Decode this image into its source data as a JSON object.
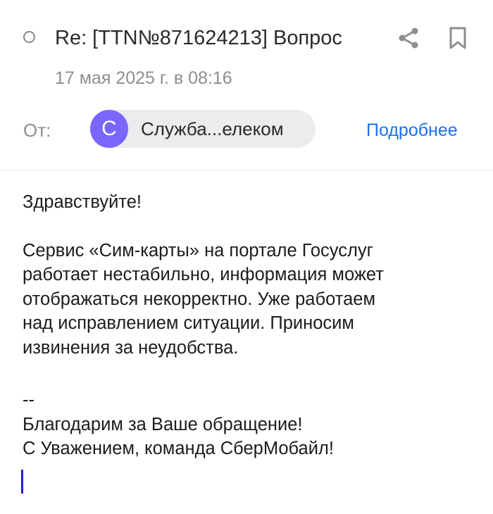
{
  "email": {
    "subject": "Re: [TTN№871624213] Вопрос",
    "date": "17 мая 2025 г. в 08:16",
    "from_label": "От:",
    "sender": {
      "avatar_letter": "С",
      "name": "Служба...елеком"
    },
    "details_link": "Подробнее",
    "icons": {
      "unread": "unread-dot-icon",
      "share": "share-icon",
      "bookmark": "bookmark-icon"
    },
    "body": {
      "greeting": "Здравствуйте!",
      "message_lines": [
        "Сервис «Сим-карты» на портале Госуслуг",
        "работает нестабильно, информация может",
        "отображаться некорректно. Уже работаем",
        "над исправлением ситуации. Приносим",
        "извинения за неудобства."
      ],
      "separator": "--",
      "signature_lines": [
        "Благодарим за Ваше обращение!",
        "С Уважением, команда СберМобайл!"
      ]
    }
  },
  "colors": {
    "avatar": "#7a66ff",
    "link": "#1a73e8",
    "caret": "#1d1ddb",
    "chip": "#ececef"
  }
}
